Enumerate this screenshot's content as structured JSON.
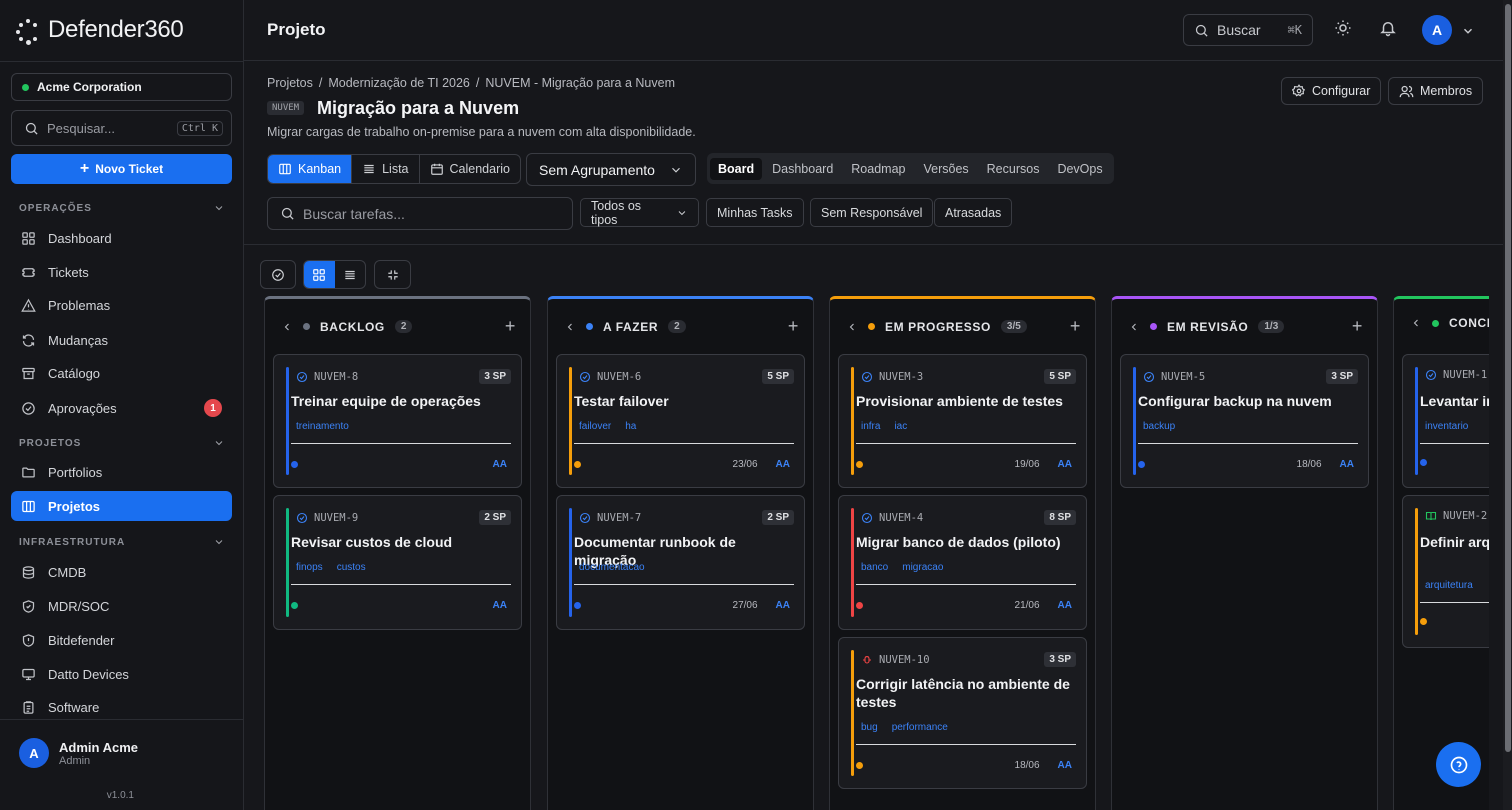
{
  "app": {
    "name": "Defender360",
    "version": "v1.0.1"
  },
  "sidebar": {
    "org": {
      "name": "Acme Corporation",
      "status_color": "#22c55e"
    },
    "search": {
      "placeholder": "Pesquisar...",
      "shortcut": "Ctrl K"
    },
    "new_ticket": "Novo Ticket",
    "sections": [
      {
        "label": "OPERAÇÕES",
        "items": [
          {
            "label": "Dashboard",
            "icon": "grid-icon"
          },
          {
            "label": "Tickets",
            "icon": "ticket-icon"
          },
          {
            "label": "Problemas",
            "icon": "alert-triangle-icon"
          },
          {
            "label": "Mudanças",
            "icon": "refresh-icon"
          },
          {
            "label": "Catálogo",
            "icon": "archive-icon"
          },
          {
            "label": "Aprovações",
            "icon": "check-circle-icon",
            "badge": "1"
          }
        ]
      },
      {
        "label": "PROJETOS",
        "items": [
          {
            "label": "Portfolios",
            "icon": "folder-icon"
          },
          {
            "label": "Projetos",
            "icon": "kanban-icon",
            "active": true
          }
        ]
      },
      {
        "label": "INFRAESTRUTURA",
        "items": [
          {
            "label": "CMDB",
            "icon": "database-icon"
          },
          {
            "label": "MDR/SOC",
            "icon": "shield-check-icon"
          },
          {
            "label": "Bitdefender",
            "icon": "shield-alert-icon"
          },
          {
            "label": "Datto Devices",
            "icon": "monitor-icon"
          },
          {
            "label": "Software",
            "icon": "clipboard-icon"
          }
        ]
      }
    ],
    "user": {
      "initial": "A",
      "name": "Admin Acme",
      "role": "Admin"
    }
  },
  "topbar": {
    "title": "Projeto",
    "search_label": "Buscar",
    "search_shortcut": "⌘K",
    "avatar_initial": "A"
  },
  "header": {
    "breadcrumbs": [
      "Projetos",
      "/",
      "Modernização de TI 2026",
      "/",
      "NUVEM - Migração para a Nuvem"
    ],
    "project_code": "NUVEM",
    "project_name": "Migração para a Nuvem",
    "project_desc": "Migrar cargas de trabalho on-premise para a nuvem com alta disponibilidade.",
    "configure": "Configurar",
    "members": "Membros",
    "view_modes": [
      "Kanban",
      "Lista",
      "Calendario"
    ],
    "grouping": "Sem Agrupamento",
    "views": [
      "Board",
      "Dashboard",
      "Roadmap",
      "Versões",
      "Recursos",
      "DevOps"
    ],
    "task_search_placeholder": "Buscar tarefas...",
    "type_filter": "Todos os tipos",
    "filters": [
      "Minhas Tasks",
      "Sem Responsável",
      "Atrasadas"
    ]
  },
  "colors": {
    "accent": "#1a6ff0",
    "backlog": "#6b7280",
    "todo": "#3b82f6",
    "progress": "#f59e0b",
    "review": "#a855f7",
    "done": "#22c55e"
  },
  "columns": [
    {
      "name": "BACKLOG",
      "count": "2",
      "color": "#6b7280",
      "cards": [
        {
          "id": "NUVEM-8",
          "sp": "3 SP",
          "title": "Treinar equipe de operações",
          "tags": [
            "treinamento"
          ],
          "date": "",
          "assignee": "AA",
          "bar": "#2563eb",
          "prio": "#2563eb",
          "icon": "task"
        },
        {
          "id": "NUVEM-9",
          "sp": "2 SP",
          "title": "Revisar custos de cloud",
          "tags": [
            "finops",
            "custos"
          ],
          "date": "",
          "assignee": "AA",
          "bar": "#10b981",
          "prio": "#10b981",
          "icon": "task"
        }
      ]
    },
    {
      "name": "A FAZER",
      "count": "2",
      "color": "#3b82f6",
      "cards": [
        {
          "id": "NUVEM-6",
          "sp": "5 SP",
          "title": "Testar failover",
          "tags": [
            "failover",
            "ha"
          ],
          "date": "23/06",
          "assignee": "AA",
          "bar": "#f59e0b",
          "prio": "#f59e0b",
          "icon": "task"
        },
        {
          "id": "NUVEM-7",
          "sp": "2 SP",
          "title": "Documentar runbook de migração",
          "tags": [
            "documentacao"
          ],
          "date": "27/06",
          "assignee": "AA",
          "bar": "#2563eb",
          "prio": "#2563eb",
          "icon": "task"
        }
      ]
    },
    {
      "name": "EM PROGRESSO",
      "count": "3/5",
      "color": "#f59e0b",
      "cards": [
        {
          "id": "NUVEM-3",
          "sp": "5 SP",
          "title": "Provisionar ambiente de testes",
          "tags": [
            "infra",
            "iac"
          ],
          "date": "19/06",
          "assignee": "AA",
          "bar": "#f59e0b",
          "prio": "#f59e0b",
          "icon": "task"
        },
        {
          "id": "NUVEM-4",
          "sp": "8 SP",
          "title": "Migrar banco de dados (piloto)",
          "tags": [
            "banco",
            "migracao"
          ],
          "date": "21/06",
          "assignee": "AA",
          "bar": "#ef4444",
          "prio": "#ef4444",
          "icon": "task"
        },
        {
          "id": "NUVEM-10",
          "sp": "3 SP",
          "title": "Corrigir latência no ambiente de testes",
          "tags": [
            "bug",
            "performance"
          ],
          "date": "18/06",
          "assignee": "AA",
          "bar": "#f59e0b",
          "prio": "#f59e0b",
          "icon": "bug"
        }
      ]
    },
    {
      "name": "EM REVISÃO",
      "count": "1/3",
      "color": "#a855f7",
      "cards": [
        {
          "id": "NUVEM-5",
          "sp": "3 SP",
          "title": "Configurar backup na nuvem",
          "tags": [
            "backup"
          ],
          "date": "18/06",
          "assignee": "AA",
          "bar": "#2563eb",
          "prio": "#2563eb",
          "icon": "task"
        }
      ]
    },
    {
      "name": "CONCL",
      "count": "",
      "color": "#22c55e",
      "cards": [
        {
          "id": "NUVEM-1",
          "sp": "",
          "title": "Levantar in",
          "tags": [
            "inventario"
          ],
          "date": "",
          "assignee": "",
          "bar": "#2563eb",
          "prio": "#2563eb",
          "icon": "task"
        },
        {
          "id": "NUVEM-2",
          "sp": "",
          "title": "Definir arqu nuvem",
          "tags": [
            "arquitetura"
          ],
          "date": "",
          "assignee": "",
          "bar": "#f59e0b",
          "prio": "#f59e0b",
          "icon": "story"
        }
      ]
    }
  ]
}
